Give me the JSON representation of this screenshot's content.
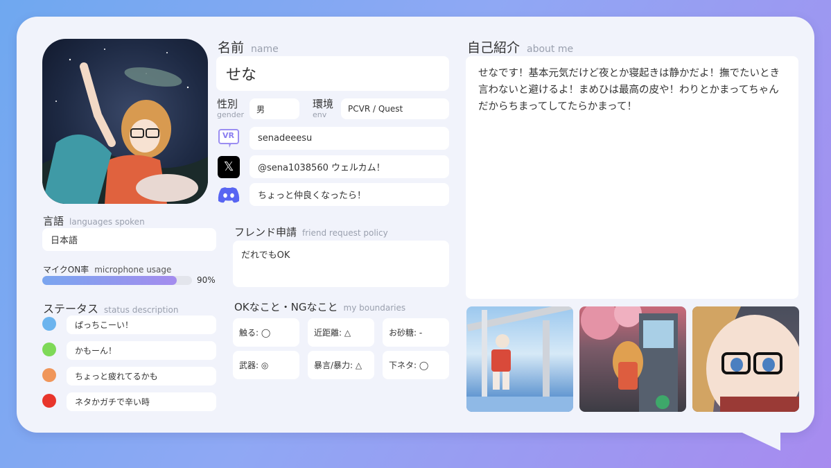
{
  "name": {
    "label_jp": "名前",
    "label_en": "name",
    "value": "せな"
  },
  "gender": {
    "label_jp": "性別",
    "label_en": "gender",
    "value": "男"
  },
  "env": {
    "label_jp": "環境",
    "label_en": "env",
    "value": "PCVR / Quest"
  },
  "socials": {
    "vrchat": {
      "icon": "vrchat-icon",
      "icon_text": "VR",
      "value": "senadeeesu"
    },
    "x": {
      "icon": "x-logo-icon",
      "icon_text": "𝕏",
      "value": "@sena1038560 ウェルカム！"
    },
    "discord": {
      "icon": "discord-icon",
      "value": "ちょっと仲良くなったら！"
    }
  },
  "languages": {
    "label_jp": "言語",
    "label_en": "languages spoken",
    "value": "日本語"
  },
  "mic": {
    "label_jp": "マイクON率",
    "label_en": "microphone usage",
    "percent": 90,
    "value_text": "90%"
  },
  "status": {
    "label_jp": "ステータス",
    "label_en": "status description",
    "items": [
      {
        "color": "#6cb4ee",
        "text": "ぱっちこーい！"
      },
      {
        "color": "#7ed957",
        "text": "かもーん！"
      },
      {
        "color": "#f0965a",
        "text": "ちょっと疲れてるかも"
      },
      {
        "color": "#e8352b",
        "text": "ネタかガチで辛い時"
      }
    ]
  },
  "friend_request": {
    "label_jp": "フレンド申請",
    "label_en": "friend request policy",
    "value": "だれでもOK"
  },
  "boundaries": {
    "label_jp": "OKなこと・NGなこと",
    "label_en": "my boundaries",
    "items": [
      "触る: ◯",
      "近距離: △",
      "お砂糖: -",
      "武器: ◎",
      "暴言/暴力: △",
      "下ネタ: ◯"
    ]
  },
  "about": {
    "label_jp": "自己紹介",
    "label_en": "about me",
    "text": "せなです！基本元気だけど夜とか寝起きは静かだよ！撫でたいとき言わないと避けるよ！まめひは最高の皮や！わりとかまってちゃんだからちまってしてたらかまって！"
  },
  "colors": {
    "accent": "#a99af0",
    "mic_bar_start": "#7aa5ef",
    "mic_bar_end": "#a48cee"
  }
}
